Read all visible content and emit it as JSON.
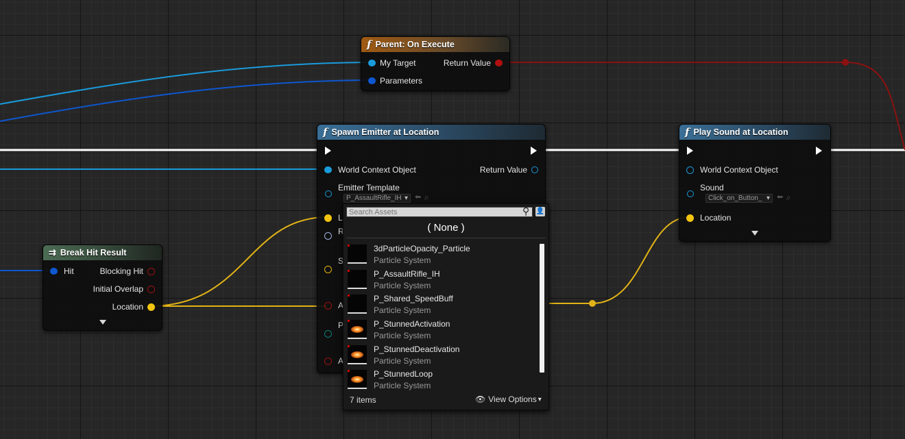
{
  "colors": {
    "exec": "#ffffff",
    "object_pin": "#1a9bdc",
    "struct_pin": "#0e57d1",
    "vector_pin": "#f1c40f",
    "bool_pin": "#9b0f0f",
    "return_wire": "#8c1111"
  },
  "nodes": {
    "parent_on_execute": {
      "title": "Parent: On Execute",
      "icon": "function-icon",
      "pins": {
        "my_target": "My Target",
        "parameters": "Parameters",
        "return_value": "Return Value"
      }
    },
    "spawn_emitter": {
      "title": "Spawn Emitter at Location",
      "icon": "function-icon",
      "pins": {
        "world_context": "World Context Object",
        "return_value": "Return Value",
        "emitter_template": "Emitter Template",
        "emitter_template_value": "P_AssaultRifle_IH",
        "location_initial": "L",
        "rotation_initial": "R",
        "scale_initial": "S",
        "auto_destroy_initial": "A",
        "pooling_initial": "P",
        "auto_activate_initial": "A"
      }
    },
    "play_sound": {
      "title": "Play Sound at Location",
      "icon": "function-icon",
      "pins": {
        "world_context": "World Context Object",
        "sound": "Sound",
        "sound_value": "Click_on_Button_",
        "location": "Location"
      }
    },
    "break_hit_result": {
      "title": "Break Hit Result",
      "icon": "break-struct-icon",
      "pins": {
        "hit": "Hit",
        "blocking_hit": "Blocking Hit",
        "initial_overlap": "Initial Overlap",
        "location": "Location"
      }
    }
  },
  "asset_picker": {
    "search_placeholder": "Search Assets",
    "none_label": "( None )",
    "items": [
      {
        "name": "3dParticleOpacity_Particle",
        "type": "Particle System",
        "thumb": "dark"
      },
      {
        "name": "P_AssaultRifle_IH",
        "type": "Particle System",
        "thumb": "dark"
      },
      {
        "name": "P_Shared_SpeedBuff",
        "type": "Particle System",
        "thumb": "dark"
      },
      {
        "name": "P_StunnedActivation",
        "type": "Particle System",
        "thumb": "glow"
      },
      {
        "name": "P_StunnedDeactivation",
        "type": "Particle System",
        "thumb": "glow"
      },
      {
        "name": "P_StunnedLoop",
        "type": "Particle System",
        "thumb": "glow"
      }
    ],
    "item_count": "7 items",
    "view_options": "View Options"
  }
}
